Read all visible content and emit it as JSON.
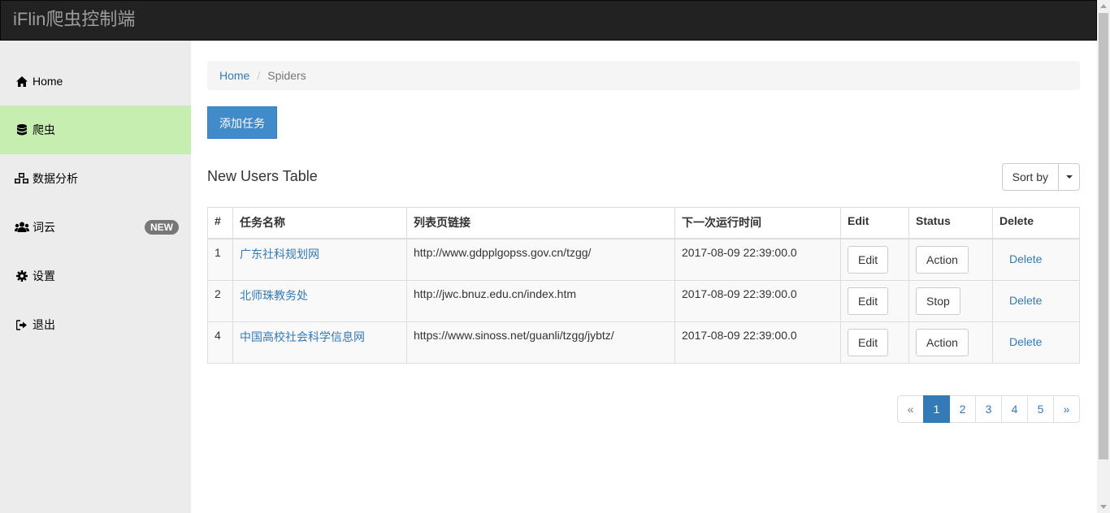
{
  "app": {
    "brand": "iFlin爬虫控制端"
  },
  "sidebar": {
    "items": [
      {
        "label": "Home",
        "icon": "home-icon"
      },
      {
        "label": "爬虫",
        "icon": "database-icon",
        "active": true
      },
      {
        "label": "数据分析",
        "icon": "cubes-icon"
      },
      {
        "label": "词云",
        "icon": "users-icon",
        "badge": "NEW"
      },
      {
        "label": "设置",
        "icon": "gear-icon"
      },
      {
        "label": "退出",
        "icon": "sign-out-icon"
      }
    ]
  },
  "breadcrumb": {
    "home": "Home",
    "separator": "/",
    "current": "Spiders"
  },
  "actions": {
    "add_task": "添加任务"
  },
  "table": {
    "title": "New Users Table",
    "sort_label": "Sort by",
    "columns": [
      "#",
      "任务名称",
      "列表页链接",
      "下一次运行时间",
      "Edit",
      "Status",
      "Delete"
    ],
    "rows": [
      {
        "id": "1",
        "name": "广东社科规划网",
        "url": "http://www.gdpplgopss.gov.cn/tzgg/",
        "next_run": "2017-08-09 22:39:00.0",
        "edit": "Edit",
        "status": "Action",
        "delete": "Delete"
      },
      {
        "id": "2",
        "name": "北师珠教务处",
        "url": "http://jwc.bnuz.edu.cn/index.htm",
        "next_run": "2017-08-09 22:39:00.0",
        "edit": "Edit",
        "status": "Stop",
        "delete": "Delete"
      },
      {
        "id": "4",
        "name": "中国高校社会科学信息网",
        "url": "https://www.sinoss.net/guanli/tzgg/jybtz/",
        "next_run": "2017-08-09 22:39:00.0",
        "edit": "Edit",
        "status": "Action",
        "delete": "Delete"
      }
    ]
  },
  "pagination": {
    "prev": "«",
    "pages": [
      "1",
      "2",
      "3",
      "4",
      "5"
    ],
    "next": "»",
    "current": "1"
  },
  "colors": {
    "active_nav": "#c6eeb0",
    "primary": "#428bca",
    "link": "#337ab7",
    "topbar": "#222222"
  }
}
